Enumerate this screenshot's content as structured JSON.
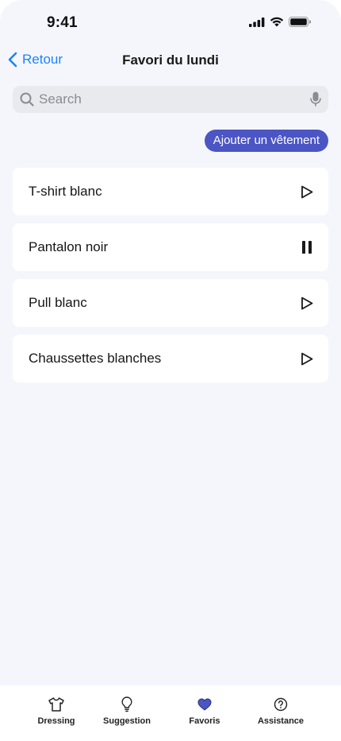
{
  "status_bar": {
    "time": "9:41"
  },
  "nav": {
    "back_label": "Retour",
    "title": "Favori du lundi"
  },
  "search": {
    "placeholder": "Search",
    "value": ""
  },
  "actions": {
    "add_label": "Ajouter un vêtement"
  },
  "items": [
    {
      "label": "T-shirt blanc",
      "state": "play"
    },
    {
      "label": "Pantalon noir",
      "state": "pause"
    },
    {
      "label": "Pull blanc",
      "state": "play"
    },
    {
      "label": "Chaussettes blanches",
      "state": "play"
    }
  ],
  "tabs": [
    {
      "label": "Dressing",
      "icon": "tshirt-icon"
    },
    {
      "label": "Suggestion",
      "icon": "lightbulb-icon"
    },
    {
      "label": "Favoris",
      "icon": "heart-icon",
      "active": true
    },
    {
      "label": "Assistance",
      "icon": "question-circle-icon"
    }
  ],
  "colors": {
    "accent": "#4b55c4",
    "link": "#1a84ff",
    "background": "#f5f6fc"
  }
}
